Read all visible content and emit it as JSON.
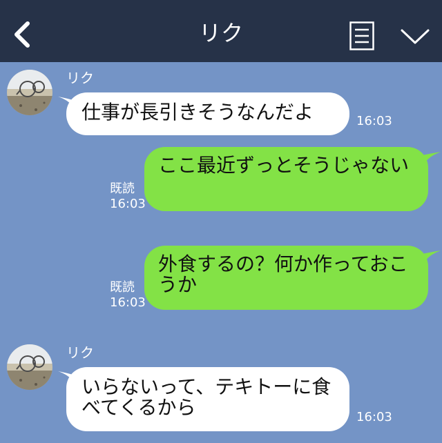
{
  "header": {
    "title": "リク"
  },
  "messages": [
    {
      "sender": "リク",
      "text": "仕事が長引きそうなんだよ",
      "time": "16:03"
    },
    {
      "text": "ここ最近ずっとそうじゃない",
      "read": "既読",
      "time": "16:03"
    },
    {
      "text": "外食するの？何か作っておこうか",
      "read": "既読",
      "time": "16:03"
    },
    {
      "sender": "リク",
      "text": "いらないって、テキトーに食べてくるから",
      "time": "16:03"
    }
  ],
  "colors": {
    "header_bg": "#263248",
    "chat_bg": "#7494c6",
    "sent_bubble": "#83e246",
    "received_bubble": "#ffffff"
  },
  "icons": [
    "back-arrow-icon",
    "memo-icon",
    "chevron-down-icon"
  ]
}
